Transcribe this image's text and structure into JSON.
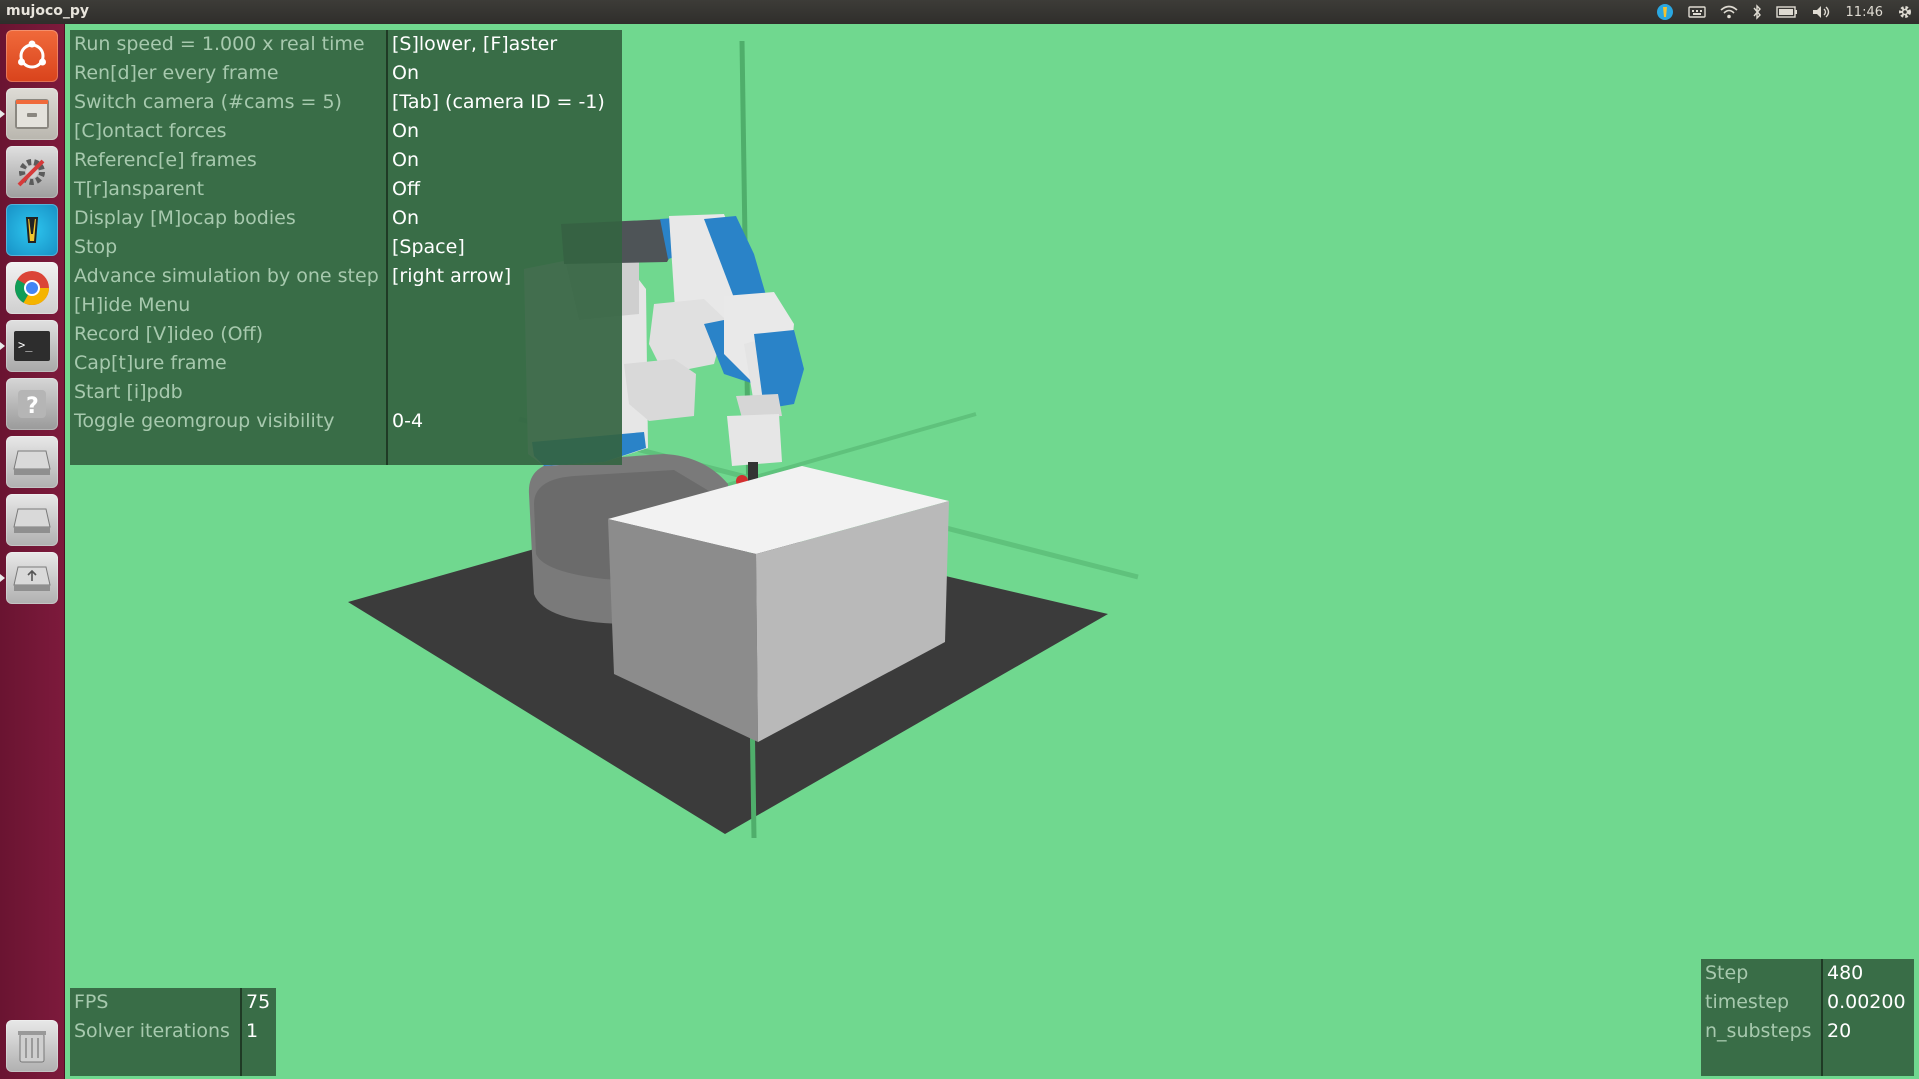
{
  "window": {
    "title": "mujoco_py"
  },
  "tray": {
    "clock": "11:46"
  },
  "launcher": {
    "items": [
      {
        "name": "dash-icon"
      },
      {
        "name": "files-icon"
      },
      {
        "name": "settings-icon"
      },
      {
        "name": "app-icon"
      },
      {
        "name": "chrome-icon"
      },
      {
        "name": "terminal-icon"
      },
      {
        "name": "help-icon"
      },
      {
        "name": "drive-icon"
      },
      {
        "name": "drive-icon-2"
      },
      {
        "name": "usb-drive-icon"
      },
      {
        "name": "trash-icon"
      }
    ]
  },
  "help_menu": {
    "rows": [
      {
        "key": "Run speed = 1.000 x real time",
        "value": "[S]lower, [F]aster"
      },
      {
        "key": "Ren[d]er every frame",
        "value": "On"
      },
      {
        "key": "Switch camera (#cams = 5)",
        "value": "[Tab] (camera ID = -1)"
      },
      {
        "key": "[C]ontact forces",
        "value": "On"
      },
      {
        "key": "Referenc[e] frames",
        "value": "On"
      },
      {
        "key": "T[r]ansparent",
        "value": "Off"
      },
      {
        "key": "Display [M]ocap bodies",
        "value": "On"
      },
      {
        "key": "Stop",
        "value": "[Space]"
      },
      {
        "key": "Advance simulation by one step",
        "value": "[right arrow]"
      },
      {
        "key": "[H]ide Menu",
        "value": ""
      },
      {
        "key": "Record [V]ideo (Off)",
        "value": ""
      },
      {
        "key": "Cap[t]ure frame",
        "value": ""
      },
      {
        "key": "Start [i]pdb",
        "value": ""
      },
      {
        "key": "Toggle geomgroup visibility",
        "value": "0-4"
      }
    ]
  },
  "fps_panel": {
    "rows": [
      {
        "key": "FPS",
        "value": "75"
      },
      {
        "key": "Solver iterations",
        "value": "1"
      }
    ]
  },
  "step_panel": {
    "rows": [
      {
        "key": "Step",
        "value": "480"
      },
      {
        "key": "timestep",
        "value": "0.00200"
      },
      {
        "key": "n_substeps",
        "value": "20"
      }
    ]
  },
  "colors": {
    "background": "#70d88f",
    "floor": "#3b3b3b",
    "robot_blue": "#2a83c8",
    "launcher": "#6a1431"
  }
}
